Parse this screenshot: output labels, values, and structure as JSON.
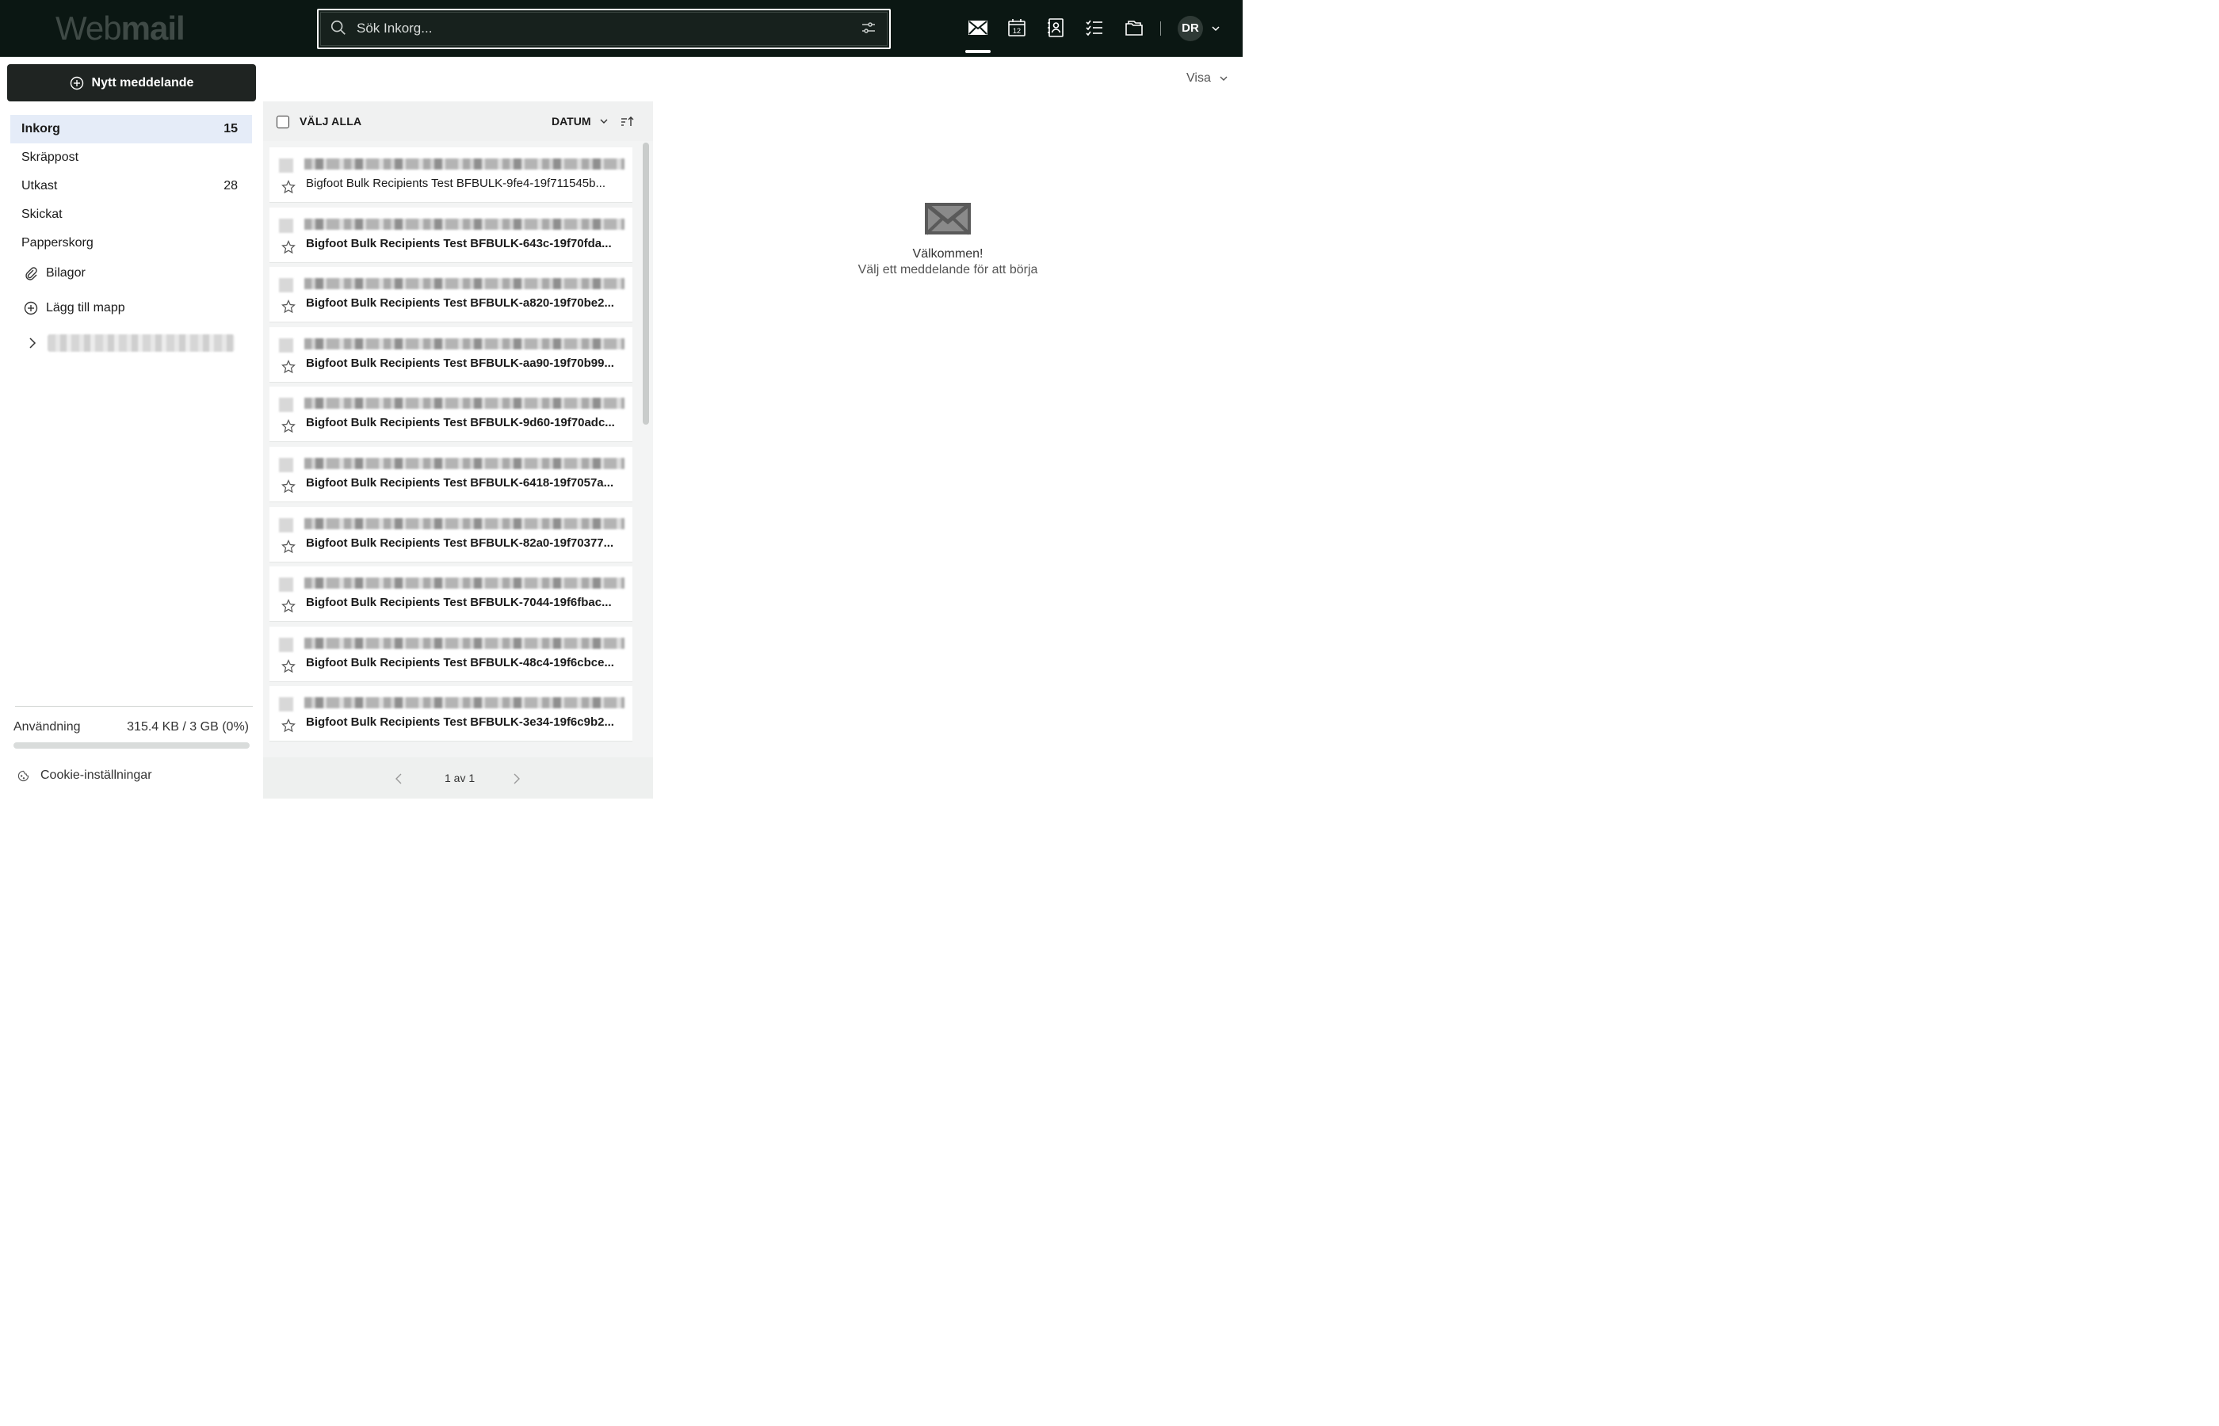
{
  "app": {
    "logo_part1": "Web",
    "logo_part2": "mail"
  },
  "search": {
    "placeholder": "Sök Inkorg..."
  },
  "user": {
    "initials": "DR"
  },
  "sidebar": {
    "new_message": "Nytt meddelande",
    "folders": [
      {
        "label": "Inkorg",
        "count": "15"
      },
      {
        "label": "Skräppost",
        "count": ""
      },
      {
        "label": "Utkast",
        "count": "28"
      },
      {
        "label": "Skickat",
        "count": ""
      },
      {
        "label": "Papperskorg",
        "count": ""
      }
    ],
    "attachments": "Bilagor",
    "add_folder": "Lägg till mapp",
    "usage_label": "Användning",
    "usage_value": "315.4 KB / 3 GB (0%)",
    "usage_fraction": 0.0,
    "cookie": "Cookie-inställningar"
  },
  "view": {
    "label": "Visa"
  },
  "list": {
    "select_all": "VÄLJ ALLA",
    "sort": "DATUM",
    "messages": [
      {
        "subject": "Bigfoot Bulk Recipients Test BFBULK-9fe4-19f711545b...",
        "unread": false
      },
      {
        "subject": "Bigfoot Bulk Recipients Test BFBULK-643c-19f70fda...",
        "unread": true
      },
      {
        "subject": "Bigfoot Bulk Recipients Test BFBULK-a820-19f70be2...",
        "unread": true
      },
      {
        "subject": "Bigfoot Bulk Recipients Test BFBULK-aa90-19f70b99...",
        "unread": true
      },
      {
        "subject": "Bigfoot Bulk Recipients Test BFBULK-9d60-19f70adc...",
        "unread": true
      },
      {
        "subject": "Bigfoot Bulk Recipients Test BFBULK-6418-19f7057a...",
        "unread": true
      },
      {
        "subject": "Bigfoot Bulk Recipients Test BFBULK-82a0-19f70377...",
        "unread": true
      },
      {
        "subject": "Bigfoot Bulk Recipients Test BFBULK-7044-19f6fbac...",
        "unread": true
      },
      {
        "subject": "Bigfoot Bulk Recipients Test BFBULK-48c4-19f6cbce...",
        "unread": true
      },
      {
        "subject": "Bigfoot Bulk Recipients Test BFBULK-3e34-19f6c9b2...",
        "unread": true
      }
    ],
    "pager": "1 av 1"
  },
  "reading_pane": {
    "welcome_title": "Välkommen!",
    "welcome_sub": "Välj ett meddelande för att börja"
  }
}
